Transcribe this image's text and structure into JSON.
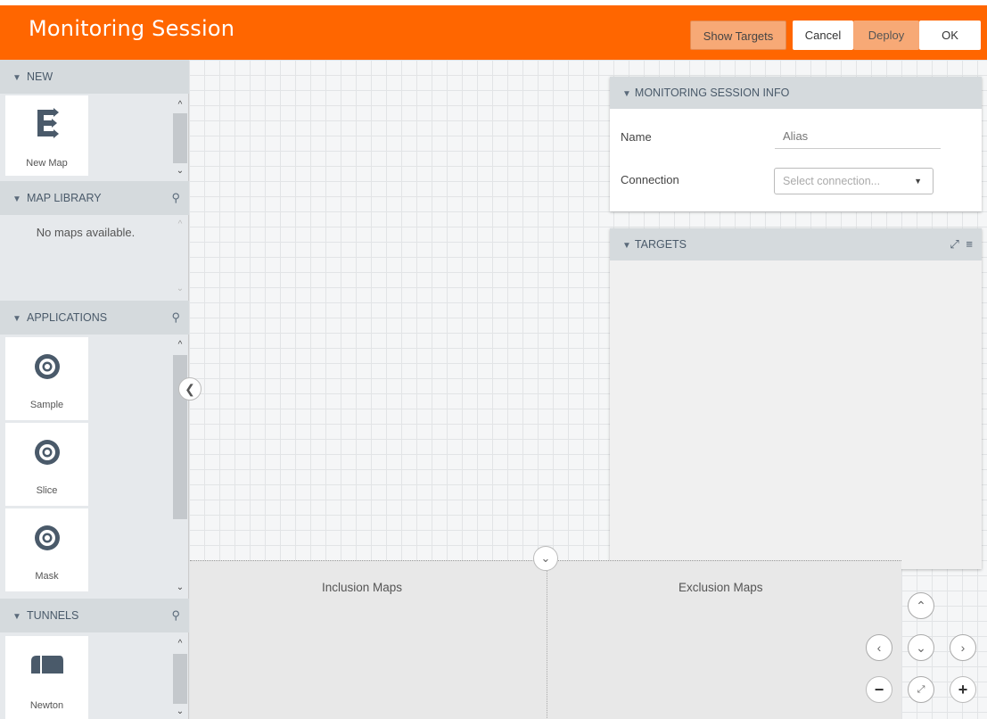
{
  "header": {
    "title": "Monitoring Session",
    "show_targets": "Show Targets",
    "cancel": "Cancel",
    "deploy": "Deploy",
    "ok": "OK"
  },
  "sidebar": {
    "new": {
      "label": "NEW",
      "items": [
        {
          "label": "New Map",
          "icon": "new-map-icon"
        }
      ]
    },
    "map_library": {
      "label": "MAP LIBRARY",
      "empty": "No maps available."
    },
    "applications": {
      "label": "APPLICATIONS",
      "items": [
        {
          "label": "Sample",
          "icon": "gear-icon"
        },
        {
          "label": "Slice",
          "icon": "gear-icon"
        },
        {
          "label": "Mask",
          "icon": "gear-icon"
        }
      ]
    },
    "tunnels": {
      "label": "TUNNELS",
      "items": [
        {
          "label": "Newton",
          "icon": "tunnel-icon"
        }
      ]
    }
  },
  "info_panel": {
    "title": "MONITORING SESSION INFO",
    "name_label": "Name",
    "name_placeholder": "Alias",
    "connection_label": "Connection",
    "connection_placeholder": "Select connection..."
  },
  "targets_panel": {
    "title": "TARGETS"
  },
  "maps": {
    "inclusion": "Inclusion Maps",
    "exclusion": "Exclusion Maps"
  },
  "colors": {
    "accent": "#ff6600",
    "button_light": "#f7a976",
    "sidebar": "#e6e9ec",
    "section_header": "#d5dadd"
  }
}
